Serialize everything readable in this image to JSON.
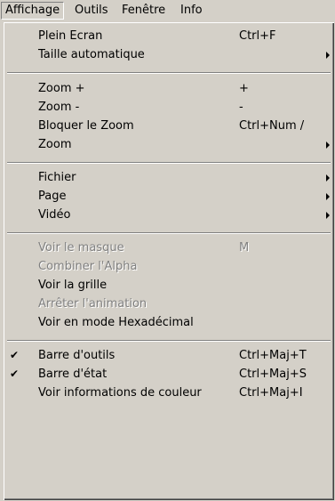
{
  "menubar": {
    "items": [
      "Affichage",
      "Outils",
      "Fenêtre",
      "Info"
    ]
  },
  "menu": {
    "items": [
      {
        "label": "Plein Ecran",
        "shortcut": "Ctrl+F"
      },
      {
        "label": "Taille automatique",
        "submenu": true
      },
      {
        "label": "Zoom +",
        "shortcut": "+"
      },
      {
        "label": "Zoom -",
        "shortcut": "-"
      },
      {
        "label": "Bloquer le Zoom",
        "shortcut": "Ctrl+Num /"
      },
      {
        "label": "Zoom",
        "submenu": true
      },
      {
        "label": "Fichier",
        "submenu": true
      },
      {
        "label": "Page",
        "submenu": true
      },
      {
        "label": "Vidéo",
        "submenu": true
      },
      {
        "label": "Voir le masque",
        "shortcut": "M",
        "disabled": true
      },
      {
        "label": "Combiner l'Alpha",
        "disabled": true
      },
      {
        "label": "Voir la grille"
      },
      {
        "label": "Arrêter l'animation",
        "disabled": true
      },
      {
        "label": "Voir en mode Hexadécimal"
      },
      {
        "label": "Barre d'outils",
        "shortcut": "Ctrl+Maj+T",
        "checked": true
      },
      {
        "label": "Barre d'état",
        "shortcut": "Ctrl+Maj+S",
        "checked": true
      },
      {
        "label": "Voir informations de couleur",
        "shortcut": "Ctrl+Maj+I"
      }
    ],
    "check_glyph": "✔"
  }
}
